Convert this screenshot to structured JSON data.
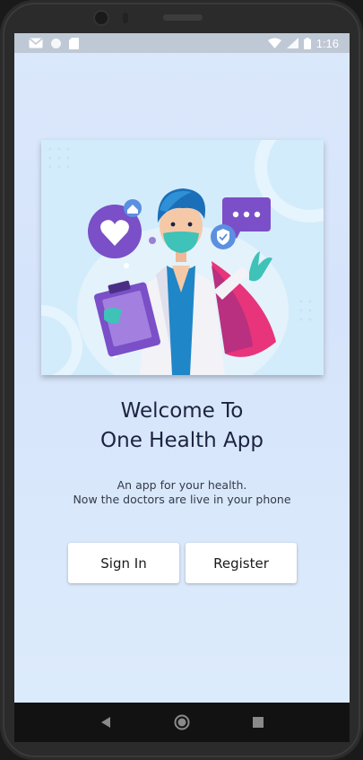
{
  "status_bar": {
    "time": "1:16",
    "icons": [
      "gmail-icon",
      "circle-icon",
      "sd-card-icon",
      "wifi-icon",
      "signal-icon",
      "battery-icon"
    ]
  },
  "hero": {
    "illustration": "doctor-illustration"
  },
  "welcome": {
    "title_line1": "Welcome To",
    "title_line2": "One Health App",
    "subtitle_line1": "An app for your health.",
    "subtitle_line2": "Now the doctors are live in your phone"
  },
  "actions": {
    "signin_label": "Sign In",
    "register_label": "Register"
  },
  "nav": {
    "icons": [
      "back-icon",
      "home-icon",
      "recents-icon"
    ]
  },
  "colors": {
    "title": "#1c2340",
    "background": "#d8e6fb",
    "navbar": "#121212",
    "accent_purple": "#7a4fc7",
    "accent_pink": "#e8347a",
    "scrubs": "#1f86c7"
  }
}
